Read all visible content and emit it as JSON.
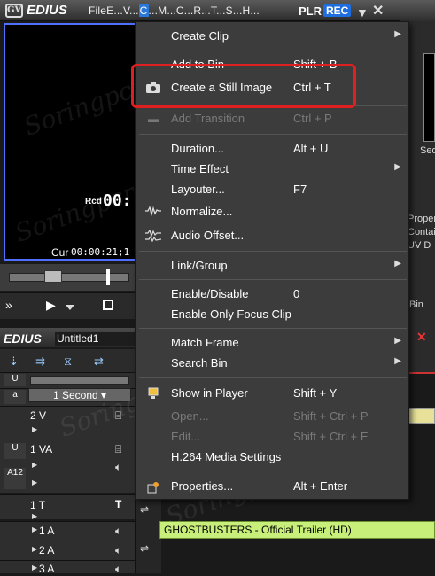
{
  "player": {
    "app_name": "EDIUS",
    "logo_text": "GV",
    "menu_before": "FileE...V...",
    "menu_active": "C",
    "menu_after": "...M...C...R...T...S...H...",
    "plr": "PLR",
    "rec": "REC",
    "minimize": "▼",
    "close": "✕",
    "rcd_label": "Rcd",
    "rec_timecode": "00:",
    "cur_label": "Cur",
    "cur_timecode": "00:00:21;1"
  },
  "timeline": {
    "app_name": "EDIUS",
    "project": "Untitled1",
    "scale": "1 Second",
    "tracks": {
      "v2": "2 V",
      "va1": "1 VA",
      "va_sub": "A1",
      "va_sub2": "2",
      "t1": "1 T",
      "a1": "1 A",
      "a2": "2 A",
      "a3": "3 A",
      "title_icon": "T"
    },
    "clip_title": "GHOSTBUSTERS - Official Trailer (HD)"
  },
  "right_panel": {
    "seq": "Seq",
    "props": [
      "Proper",
      "Contain",
      "UV D"
    ],
    "bin": "Bin"
  },
  "context_menu": {
    "items": [
      {
        "label": "Create Clip",
        "shortcut": "",
        "submenu": true,
        "disabled": false
      },
      {
        "label": "Add to Bin",
        "shortcut": "Shift + B",
        "submenu": false,
        "disabled": false
      },
      {
        "label": "Create a Still Image",
        "shortcut": "Ctrl + T",
        "submenu": false,
        "disabled": false,
        "icon": "camera-icon"
      },
      {
        "label": "Add Transition",
        "shortcut": "Ctrl + P",
        "submenu": false,
        "disabled": true,
        "icon": "transition-icon"
      },
      {
        "label": "Duration...",
        "shortcut": "Alt + U",
        "submenu": false,
        "disabled": false
      },
      {
        "label": "Time Effect",
        "shortcut": "",
        "submenu": true,
        "disabled": false
      },
      {
        "label": "Layouter...",
        "shortcut": "F7",
        "submenu": false,
        "disabled": false
      },
      {
        "label": "Normalize...",
        "shortcut": "",
        "submenu": false,
        "disabled": false,
        "icon": "waveform-icon"
      },
      {
        "label": "Audio Offset...",
        "shortcut": "",
        "submenu": false,
        "disabled": false,
        "icon": "audio-offset-icon"
      },
      {
        "label": "Link/Group",
        "shortcut": "",
        "submenu": true,
        "disabled": false
      },
      {
        "label": "Enable/Disable",
        "shortcut": "0",
        "submenu": false,
        "disabled": false
      },
      {
        "label": "Enable Only Focus Clip",
        "shortcut": "",
        "submenu": false,
        "disabled": false
      },
      {
        "label": "Match Frame",
        "shortcut": "",
        "submenu": true,
        "disabled": false
      },
      {
        "label": "Search Bin",
        "shortcut": "",
        "submenu": true,
        "disabled": false
      },
      {
        "label": "Show in Player",
        "shortcut": "Shift + Y",
        "submenu": false,
        "disabled": false,
        "icon": "player-icon"
      },
      {
        "label": "Open...",
        "shortcut": "Shift + Ctrl + P",
        "submenu": false,
        "disabled": true
      },
      {
        "label": "Edit...",
        "shortcut": "Shift + Ctrl + E",
        "submenu": false,
        "disabled": true
      },
      {
        "label": "H.264 Media Settings",
        "shortcut": "",
        "submenu": false,
        "disabled": false
      },
      {
        "label": "Properties...",
        "shortcut": "Alt + Enter",
        "submenu": false,
        "disabled": false,
        "icon": "properties-icon"
      }
    ]
  },
  "colors": {
    "highlight": "#e02020",
    "rec_badge": "#1f6ee0",
    "clip": "#c8ef7a"
  }
}
